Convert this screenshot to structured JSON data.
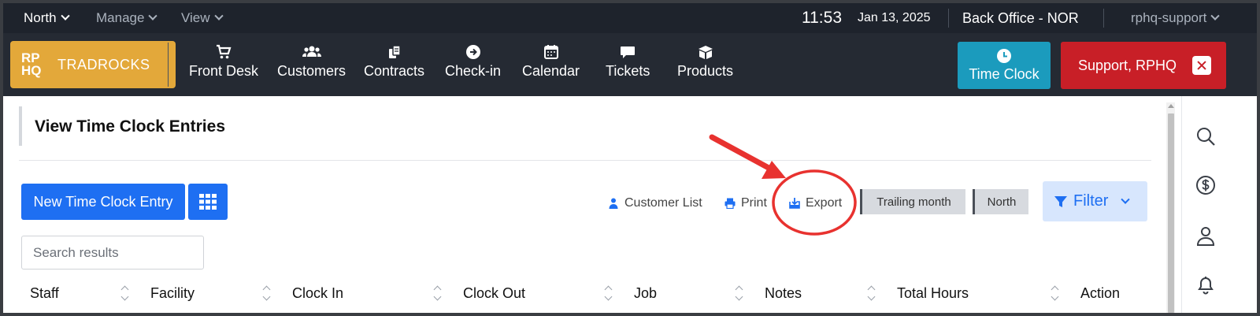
{
  "topbar": {
    "location": "North",
    "manage": "Manage",
    "view": "View",
    "time": "11:53",
    "date": "Jan 13, 2025",
    "office": "Back Office - NOR",
    "user": "rphq-support"
  },
  "logo": {
    "mark_line1": "RP",
    "mark_line2": "HQ",
    "name": "TRADROCKS"
  },
  "nav": {
    "items": [
      {
        "label": "Front Desk",
        "icon": "cart-icon"
      },
      {
        "label": "Customers",
        "icon": "users-icon"
      },
      {
        "label": "Contracts",
        "icon": "contracts-icon"
      },
      {
        "label": "Check-in",
        "icon": "arrow-circle-icon"
      },
      {
        "label": "Calendar",
        "icon": "calendar-icon"
      },
      {
        "label": "Tickets",
        "icon": "chat-icon"
      },
      {
        "label": "Products",
        "icon": "box-icon"
      }
    ],
    "time_clock": "Time Clock",
    "support": "Support, RPHQ"
  },
  "page": {
    "title": "View Time Clock Entries",
    "new_entry": "New Time Clock Entry",
    "tools": {
      "customer_list": "Customer List",
      "print": "Print",
      "export": "Export"
    },
    "range_pill": "Trailing month",
    "location_pill": "North",
    "filter": "Filter",
    "search_placeholder": "Search results"
  },
  "table": {
    "columns": [
      "Staff",
      "Facility",
      "Clock In",
      "Clock Out",
      "Job",
      "Notes",
      "Total Hours",
      "Action"
    ]
  },
  "colors": {
    "topbar": "#1e232c",
    "navbar": "#252a33",
    "logo": "#e3a83a",
    "primary": "#1e6ff2",
    "time_clock": "#1b9bbd",
    "support": "#c81f27",
    "annotation": "#e8322f"
  }
}
